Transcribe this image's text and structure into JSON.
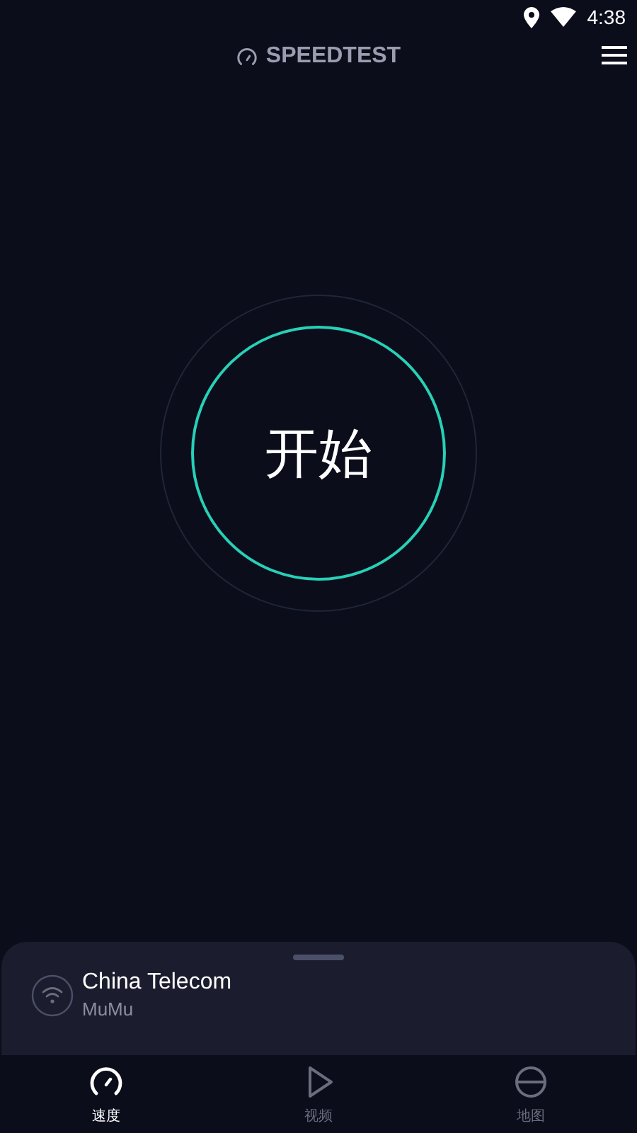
{
  "status_bar": {
    "time": "4:38"
  },
  "header": {
    "title": "SPEEDTEST"
  },
  "start_button": {
    "label": "开始"
  },
  "connection": {
    "provider": "China Telecom",
    "network": "MuMu"
  },
  "tabs": [
    {
      "label": "速度",
      "kind": "speed",
      "selected": true
    },
    {
      "label": "视频",
      "kind": "video",
      "selected": false
    },
    {
      "label": "地图",
      "kind": "map",
      "selected": false
    }
  ]
}
